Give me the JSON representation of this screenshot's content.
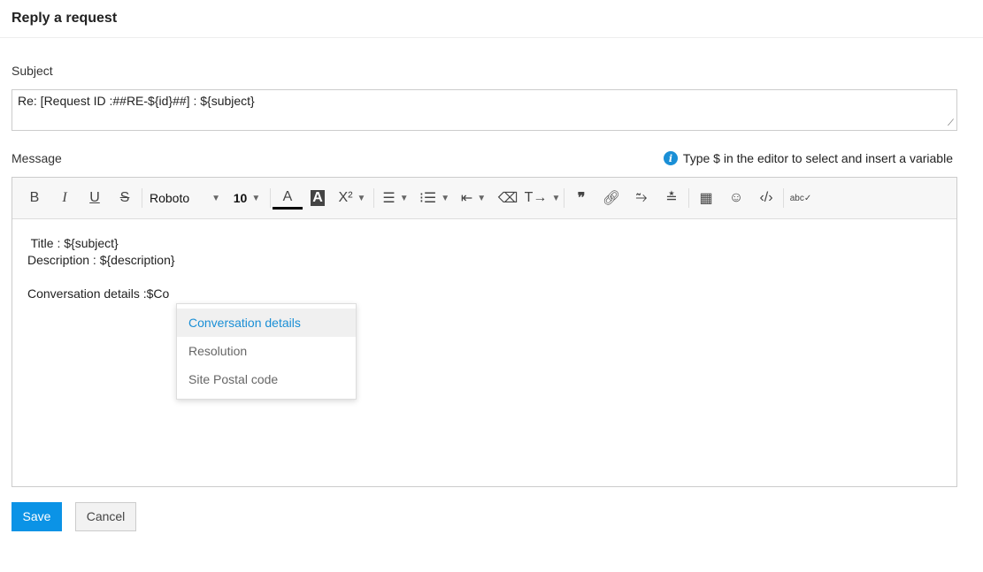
{
  "title": "Reply a request",
  "subject": {
    "label": "Subject",
    "value": "Re: [Request ID :##RE-${id}##] : ${subject}"
  },
  "message": {
    "label": "Message",
    "hint": "Type $ in the editor to select and insert a variable",
    "toolbar": {
      "font": "Roboto",
      "size": "10"
    },
    "content": [
      " Title : ${subject}",
      "Description : ${description}",
      "",
      "Conversation details :$Co"
    ]
  },
  "suggestions": [
    "Conversation details",
    "Resolution",
    "Site Postal code"
  ],
  "buttons": {
    "save": "Save",
    "cancel": "Cancel"
  },
  "colors": {
    "accent": "#0b93e6"
  }
}
